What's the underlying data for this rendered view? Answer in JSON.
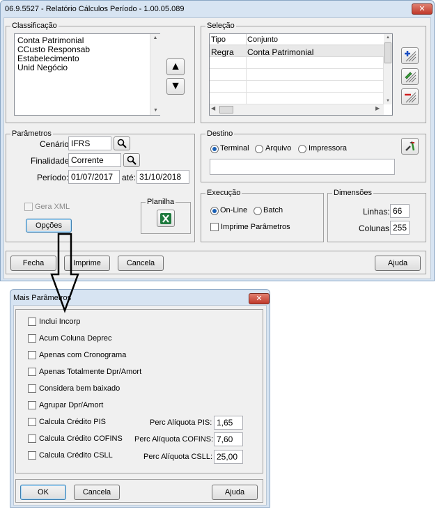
{
  "main_window": {
    "title": "06.9.5527 - Relatório Cálculos Período - 1.00.05.089",
    "close_glyph": "✕"
  },
  "classificacao": {
    "legend": "Classificação",
    "items": [
      "Conta Patrimonial",
      "CCusto Responsab",
      "Estabelecimento",
      "Unid Negócio"
    ]
  },
  "selecao": {
    "legend": "Seleção",
    "columns": [
      "Tipo",
      "Conjunto"
    ],
    "rows": [
      [
        "Regra",
        "Conta Patrimonial"
      ]
    ]
  },
  "parametros": {
    "legend": "Parâmetros",
    "cenario_label": "Cenário:",
    "cenario_value": "IFRS",
    "finalidade_label": "Finalidade:",
    "finalidade_value": "Corrente",
    "periodo_label": "Período:",
    "periodo_start": "01/07/2017",
    "ate_label": "até:",
    "periodo_end": "31/10/2018",
    "gera_xml_label": "Gera XML",
    "opcoes_label": "Opções",
    "planilha_legend": "Planilha"
  },
  "destino": {
    "legend": "Destino",
    "options": [
      "Terminal",
      "Arquivo",
      "Impressora"
    ],
    "selected": "Terminal",
    "path_value": ""
  },
  "execucao": {
    "legend": "Execução",
    "options": [
      "On-Line",
      "Batch"
    ],
    "selected": "On-Line",
    "imprime_label": "Imprime Parâmetros"
  },
  "dimensoes": {
    "legend": "Dimensões",
    "linhas_label": "Linhas:",
    "linhas_value": "66",
    "colunas_label": "Colunas:",
    "colunas_value": "255"
  },
  "footer": {
    "fecha": "Fecha",
    "imprime": "Imprime",
    "cancela": "Cancela",
    "ajuda": "Ajuda"
  },
  "dialog": {
    "title": "Mais Parâmetros",
    "close_glyph": "✕",
    "checkboxes": [
      "Inclui Incorp",
      "Acum Coluna Deprec",
      "Apenas com Cronograma",
      "Apenas Totalmente Dpr/Amort",
      "Considera bem baixado",
      "Agrupar Dpr/Amort",
      "Calcula Crédito PIS",
      "Calcula Crédito COFINS",
      "Calcula Crédito CSLL"
    ],
    "perc_pis_label": "Perc Alíquota PIS:",
    "perc_pis_value": "1,65",
    "perc_cofins_label": "Perc Alíquota COFINS:",
    "perc_cofins_value": "7,60",
    "perc_csll_label": "Perc Alíquota CSLL:",
    "perc_csll_value": "25,00",
    "ok": "OK",
    "cancela": "Cancela",
    "ajuda": "Ajuda"
  }
}
